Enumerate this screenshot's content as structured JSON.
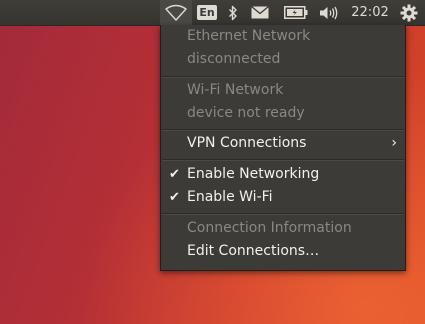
{
  "panel": {
    "language": "En",
    "clock": "22:02",
    "icons": {
      "network": "wifi-icon",
      "bluetooth": "bluetooth-icon",
      "mail": "mail-icon",
      "battery": "battery-icon",
      "volume": "volume-icon",
      "system": "gear-icon"
    }
  },
  "network_menu": {
    "ethernet_header": "Ethernet Network",
    "ethernet_status": "disconnected",
    "wifi_header": "Wi-Fi Network",
    "wifi_status": "device not ready",
    "vpn": "VPN Connections",
    "enable_networking": "Enable Networking",
    "enable_networking_checked": true,
    "enable_wifi": "Enable Wi-Fi",
    "enable_wifi_checked": true,
    "connection_info": "Connection Information",
    "edit_connections": "Edit Connections…"
  }
}
